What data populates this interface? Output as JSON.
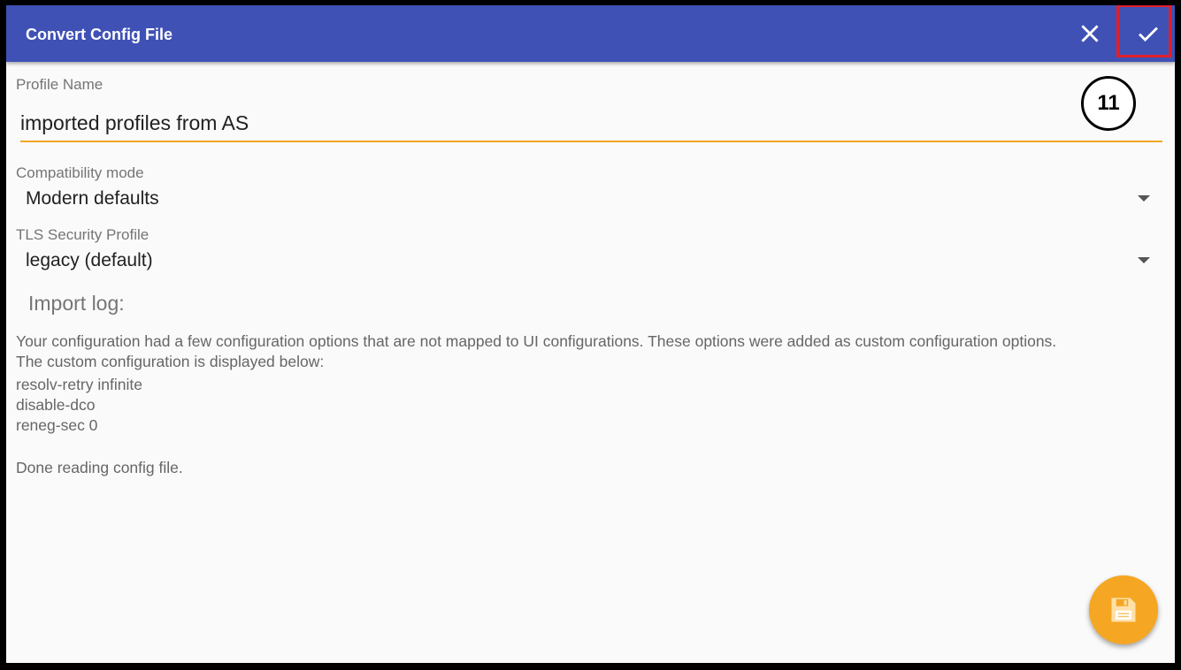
{
  "toolbar": {
    "title": "Convert Config File",
    "close_icon": "close-icon",
    "confirm_icon": "check-icon",
    "background_color": "#3f51b5",
    "highlight_color": "#e0202a"
  },
  "annotation": {
    "step_number": "11"
  },
  "profile": {
    "label": "Profile Name",
    "value": "imported profiles from AS",
    "accent_color": "#f5a623"
  },
  "compatibility": {
    "label": "Compatibility mode",
    "selected": "Modern defaults"
  },
  "tls": {
    "label": "TLS Security Profile",
    "selected": "legacy (default)"
  },
  "import_log": {
    "heading": "Import log:",
    "lines": [
      "Your configuration had a few configuration options that are not mapped to UI configurations. These options were added as custom configuration options.",
      "The custom configuration is displayed below:",
      "resolv-retry infinite",
      "disable-dco",
      "reneg-sec 0",
      "Done reading config file."
    ]
  },
  "fab": {
    "icon": "save-icon",
    "color": "#f5a623"
  }
}
